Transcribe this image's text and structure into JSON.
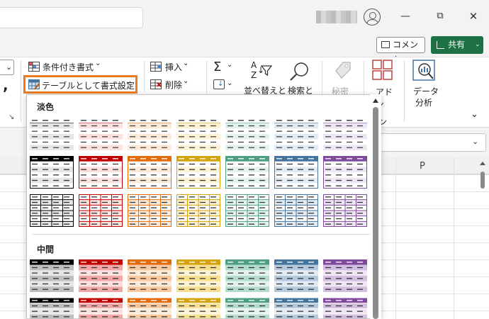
{
  "titlebar": {
    "minimize_glyph": "—",
    "restore_glyph": "⧉",
    "close_glyph": "✕"
  },
  "top_actions": {
    "comment_label": "コメント",
    "share_label": "共有",
    "share_arrow": "⌄"
  },
  "ribbon": {
    "conditional_format_label": "条件付き書式",
    "conditional_format_arrow": "⌄",
    "format_as_table_label": "テーブルとして書式設定",
    "format_as_table_arrow": "⌄",
    "insert_label": "挿入",
    "delete_label": "削除",
    "autosum_glyph": "Σ",
    "sort_filter_label": "並べ替えと",
    "find_select_label": "検索と",
    "sensitivity_label": "秘密",
    "addins_label_line1": "アド",
    "addins_label_line2": "イン",
    "data_analysis_line1": "データ",
    "data_analysis_line2": "分析",
    "collapse_glyph": "⌄",
    "dialog_launcher_glyph": "↘"
  },
  "sheet": {
    "column_P": "P"
  },
  "gallery": {
    "section_light": "淡色",
    "section_medium": "中間",
    "colors": [
      {
        "dark": "#000000",
        "mid": "#bfbfbf",
        "light": "#e6e6e6"
      },
      {
        "dark": "#c00000",
        "mid": "#f2a7a7",
        "light": "#fbe0e0"
      },
      {
        "dark": "#e36c09",
        "mid": "#f8c8a0",
        "light": "#fde9d8"
      },
      {
        "dark": "#d4a20a",
        "mid": "#f7df91",
        "light": "#fdf3d4"
      },
      {
        "dark": "#4d9e83",
        "mid": "#b4dccd",
        "light": "#e3f2ec"
      },
      {
        "dark": "#44739e",
        "mid": "#b3c9de",
        "light": "#e2ebf4"
      },
      {
        "dark": "#7f4a9c",
        "mid": "#d3bde0",
        "light": "#efe6f5"
      }
    ]
  }
}
